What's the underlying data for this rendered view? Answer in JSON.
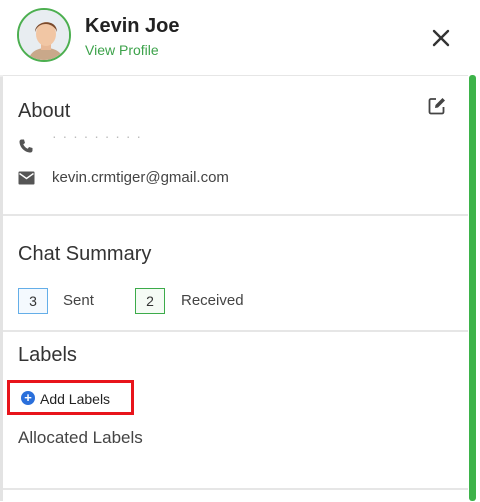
{
  "header": {
    "name": "Kevin Joe",
    "view_profile": "View Profile"
  },
  "about": {
    "title": "About",
    "phone": "· · · · · · · · ·",
    "email": "kevin.crmtiger@gmail.com"
  },
  "chat_summary": {
    "title": "Chat Summary",
    "sent_count": "3",
    "sent_label": "Sent",
    "received_count": "2",
    "received_label": "Received"
  },
  "labels": {
    "title": "Labels",
    "add_button_icon": "+",
    "add_button": "Add Labels",
    "allocated_title": "Allocated Labels"
  },
  "icons": {
    "close": "close-icon",
    "edit": "edit-icon",
    "phone": "phone-icon",
    "mail": "mail-icon",
    "plus": "plus-circle-icon"
  },
  "colors": {
    "accent_green": "#3db34a",
    "sent_blue": "#64aee8",
    "highlight_red": "#e8141b",
    "plus_blue": "#2a6fdb"
  }
}
